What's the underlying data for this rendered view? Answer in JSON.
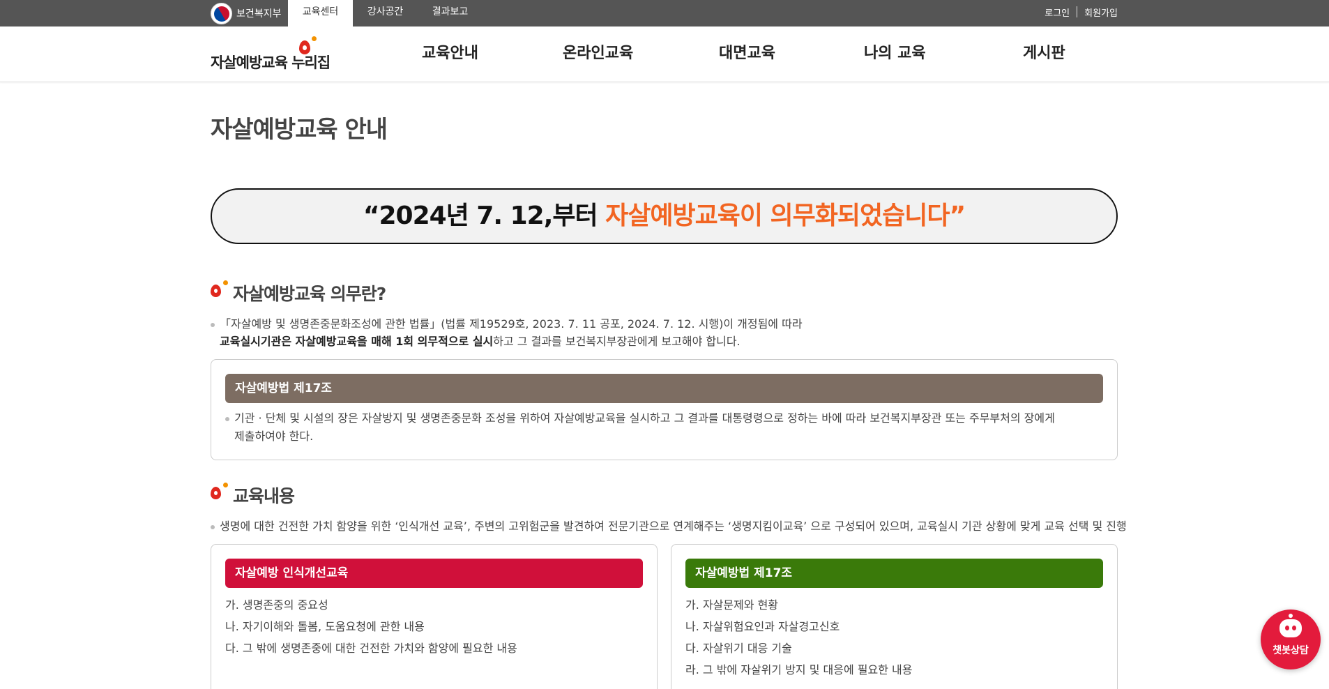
{
  "topbar": {
    "gov_name": "보건복지부",
    "tabs": [
      {
        "label": "교육센터",
        "active": true
      },
      {
        "label": "강사공간",
        "active": false
      },
      {
        "label": "결과보고",
        "active": false
      }
    ],
    "login": "로그인",
    "signup": "회원가입"
  },
  "header": {
    "logo_text": "자살예방교육 누리집",
    "nav": [
      "교육안내",
      "온라인교육",
      "대면교육",
      "나의 교육",
      "게시판"
    ]
  },
  "main": {
    "page_title": "자살예방교육 안내",
    "banner": {
      "prefix": "“2024년 7. 12,부터 ",
      "highlight": "자살예방교육이 의무화되었습니다”"
    },
    "section1": {
      "title": "자살예방교육 의무란?",
      "line1": "「자살예방 및 생명존중문화조성에 관한 법률」(법률 제19529호, 2023. 7. 11 공포, 2024. 7. 12. 시행)이 개정됨에 따라",
      "line2_bold": "교육실시기관은 자살예방교육을 매해 1회 의무적으로 실시",
      "line2_rest": "하고 그 결과를 보건복지부장관에게 보고해야 합니다.",
      "law_box": {
        "header": "자살예방법 제17조",
        "line1": "기관 · 단체 및 시설의 장은 자살방지 및 생명존중문화 조성을 위하여 자살예방교육을 실시하고 그 결과를 대통령령으로 정하는 바에 따라 보건복지부장관 또는 주무부처의 장에게",
        "line2": "제출하여야 한다."
      }
    },
    "section2": {
      "title": "교육내용",
      "desc": "생명에 대한 건전한 가치 함양을 위한 ‘인식개선 교육’, 주변의 고위험군을 발견하여 전문기관으로 연계해주는 ‘생명지킴이교육’ 으로 구성되어 있으며, 교육실시 기관 상황에 맞게 교육 선택 및 진행",
      "left_box": {
        "header": "자살예방 인식개선교육",
        "items": [
          "가. 생명존중의 중요성",
          "나. 자기이해와 돌봄, 도움요청에 관한 내용",
          "다. 그 밖에 생명존중에 대한 건전한 가치와 함양에 필요한 내용"
        ]
      },
      "right_box": {
        "header": "자살예방법 제17조",
        "items": [
          "가. 자살문제와 현황",
          "나. 자살위험요인과 자살경고신호",
          "다. 자살위기 대응 기술",
          "라. 그 밖에 자살위기 방지 및 대응에 필요한 내용"
        ]
      }
    }
  },
  "chatbot": {
    "label": "챗봇상담"
  },
  "colors": {
    "topbar_bg": "#555555",
    "accent_orange": "#f26522",
    "law_header_brown": "#7d6d62",
    "red_header": "#d0103a",
    "green_header": "#3a7a0a",
    "chatbot_red": "#e31b3c"
  }
}
